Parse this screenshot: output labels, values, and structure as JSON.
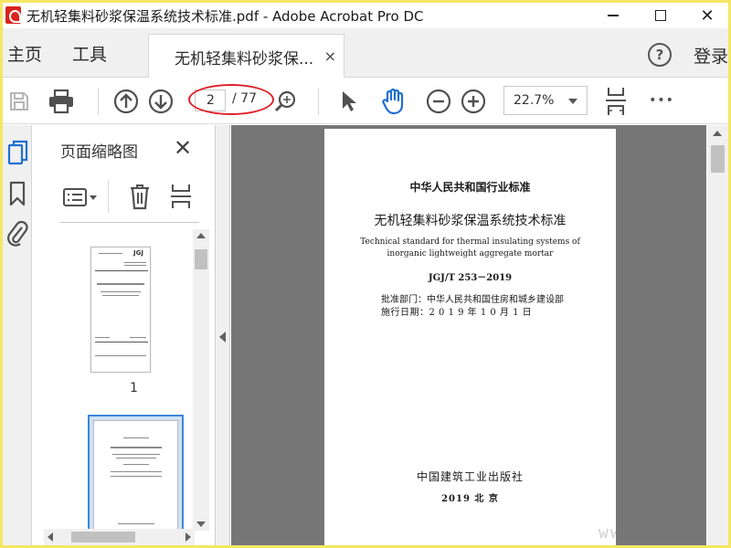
{
  "window": {
    "title": "无机轻集料砂浆保温系统技术标准.pdf - Adobe Acrobat Pro DC",
    "minimize": "minimize",
    "maximize": "maximize",
    "close": "✕"
  },
  "menu": {
    "home": "主页",
    "tools": "工具",
    "document_tab": "无机轻集料砂浆保...",
    "document_tab_close": "×",
    "help": "?",
    "login": "登录"
  },
  "toolbar": {
    "page_current": "2",
    "page_total": "/ 77",
    "zoom": "22.7%",
    "more": "•••"
  },
  "thumbnail_panel": {
    "title": "页面缩略图",
    "close": "✕",
    "thumbnails": [
      {
        "label": "1"
      },
      {
        "label": ""
      }
    ]
  },
  "document_page": {
    "category": "中华人民共和国行业标准",
    "title": "无机轻集料砂浆保温系统技术标准",
    "english_line1": "Technical standard for thermal insulating systems of",
    "english_line2": "inorganic lightweight aggregate mortar",
    "code": "JGJ/T 253－2019",
    "approved_by": "批准部门：中华人民共和国住房和城乡建设部",
    "effective_date": "施行日期：2 0 1 9 年 1 0 月 1 日",
    "publisher": "中国建筑工业出版社",
    "pub_year": "2019  北  京"
  },
  "watermark": "www.    .com",
  "colors": {
    "frame_border": "#f5e663",
    "acrobat_red": "#d9241c",
    "annotation_red": "#e0212b",
    "selected_blue": "#3d86d6",
    "doc_background": "#767676"
  }
}
